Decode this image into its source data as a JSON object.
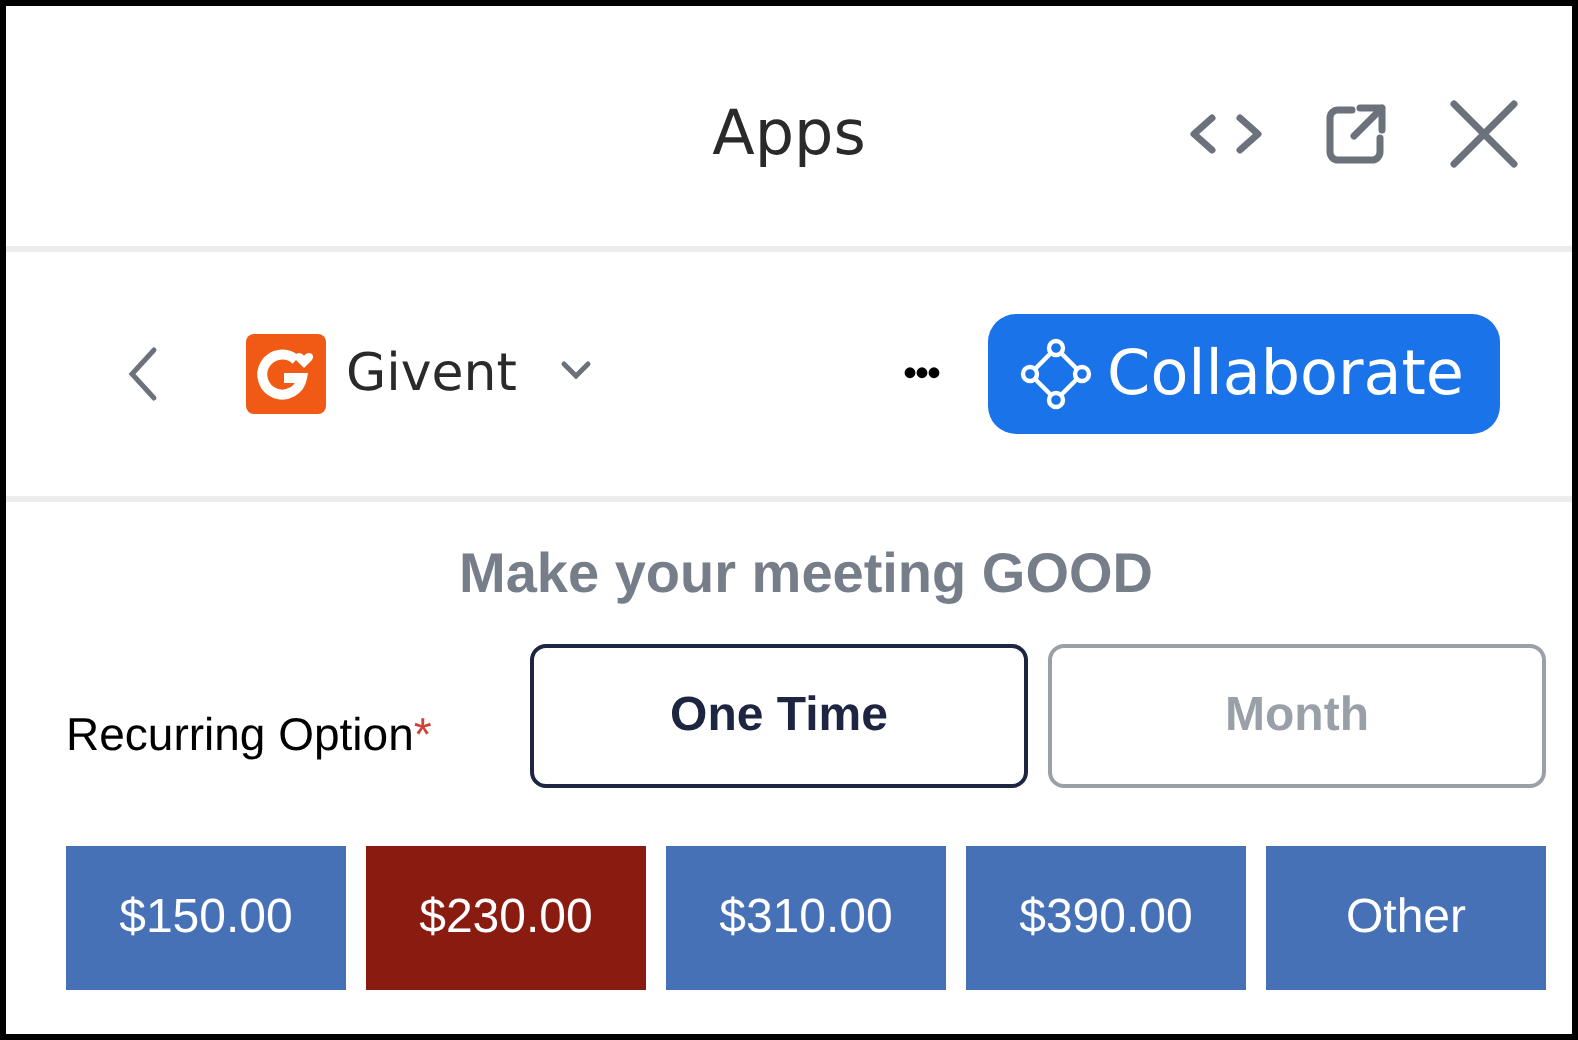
{
  "window": {
    "title": "Apps"
  },
  "toolbar": {
    "app_name": "Givent",
    "more": "•••",
    "collaborate": "Collaborate"
  },
  "form": {
    "heading": "Make your meeting GOOD",
    "recurring_label": "Recurring Option",
    "required_mark": "*",
    "recurring_options": [
      {
        "label": "One Time",
        "selected": true
      },
      {
        "label": "Month",
        "selected": false
      }
    ],
    "amounts": [
      {
        "label": "$150.00",
        "selected": false
      },
      {
        "label": "$230.00",
        "selected": true
      },
      {
        "label": "$310.00",
        "selected": false
      },
      {
        "label": "$390.00",
        "selected": false
      },
      {
        "label": "Other",
        "selected": false
      }
    ]
  }
}
